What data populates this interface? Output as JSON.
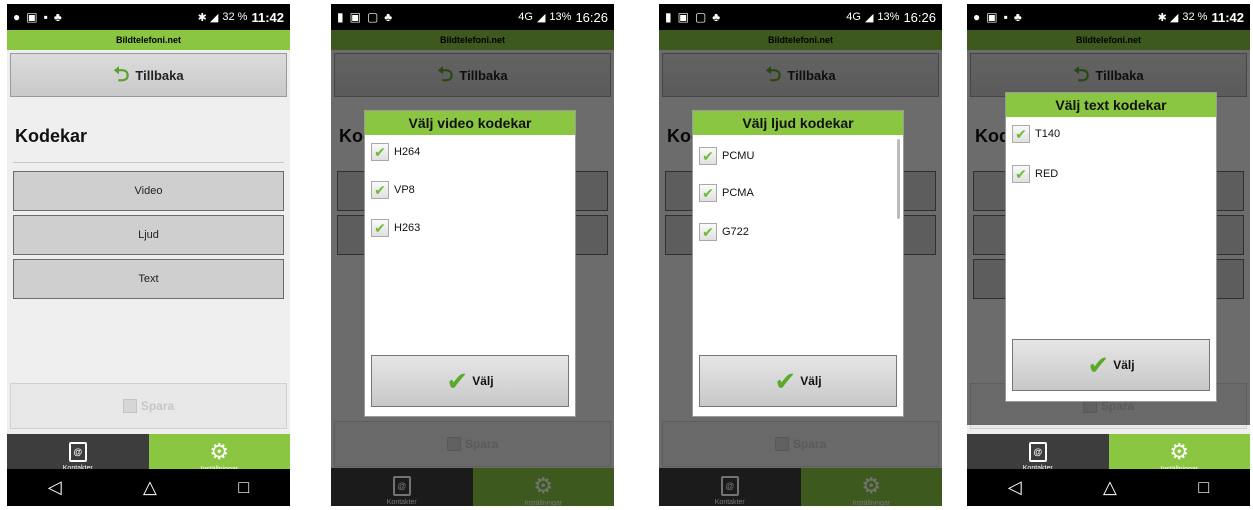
{
  "app_title": "Bildtelefoni.net",
  "back_label": "Tillbaka",
  "section_title": "Kodekar",
  "menu": [
    "Video",
    "Ljud",
    "Text"
  ],
  "save_label": "Spara",
  "nav": {
    "contacts": "Kontakter",
    "settings": "Inställningar"
  },
  "contacts_icon_glyph": "@",
  "status": {
    "a": {
      "battery": "32 %",
      "time": "11:42"
    },
    "b": {
      "network": "4G",
      "battery": "13%",
      "time": "16:26"
    }
  },
  "dialogs": {
    "video": {
      "title": "Välj video kodekar",
      "options": [
        "H264",
        "VP8",
        "H263"
      ]
    },
    "audio": {
      "title": "Välj ljud kodekar",
      "options": [
        "PCMU",
        "PCMA",
        "G722"
      ]
    },
    "text": {
      "title": "Välj text kodekar",
      "options": [
        "T140",
        "RED"
      ]
    }
  },
  "choose_label": "Välj",
  "colors": {
    "accent": "#8ac641",
    "dark": "#3d3d3d"
  },
  "icons": [
    "back-arrow-icon",
    "check-icon",
    "gear-icon",
    "contacts-icon",
    "save-disk-icon"
  ]
}
